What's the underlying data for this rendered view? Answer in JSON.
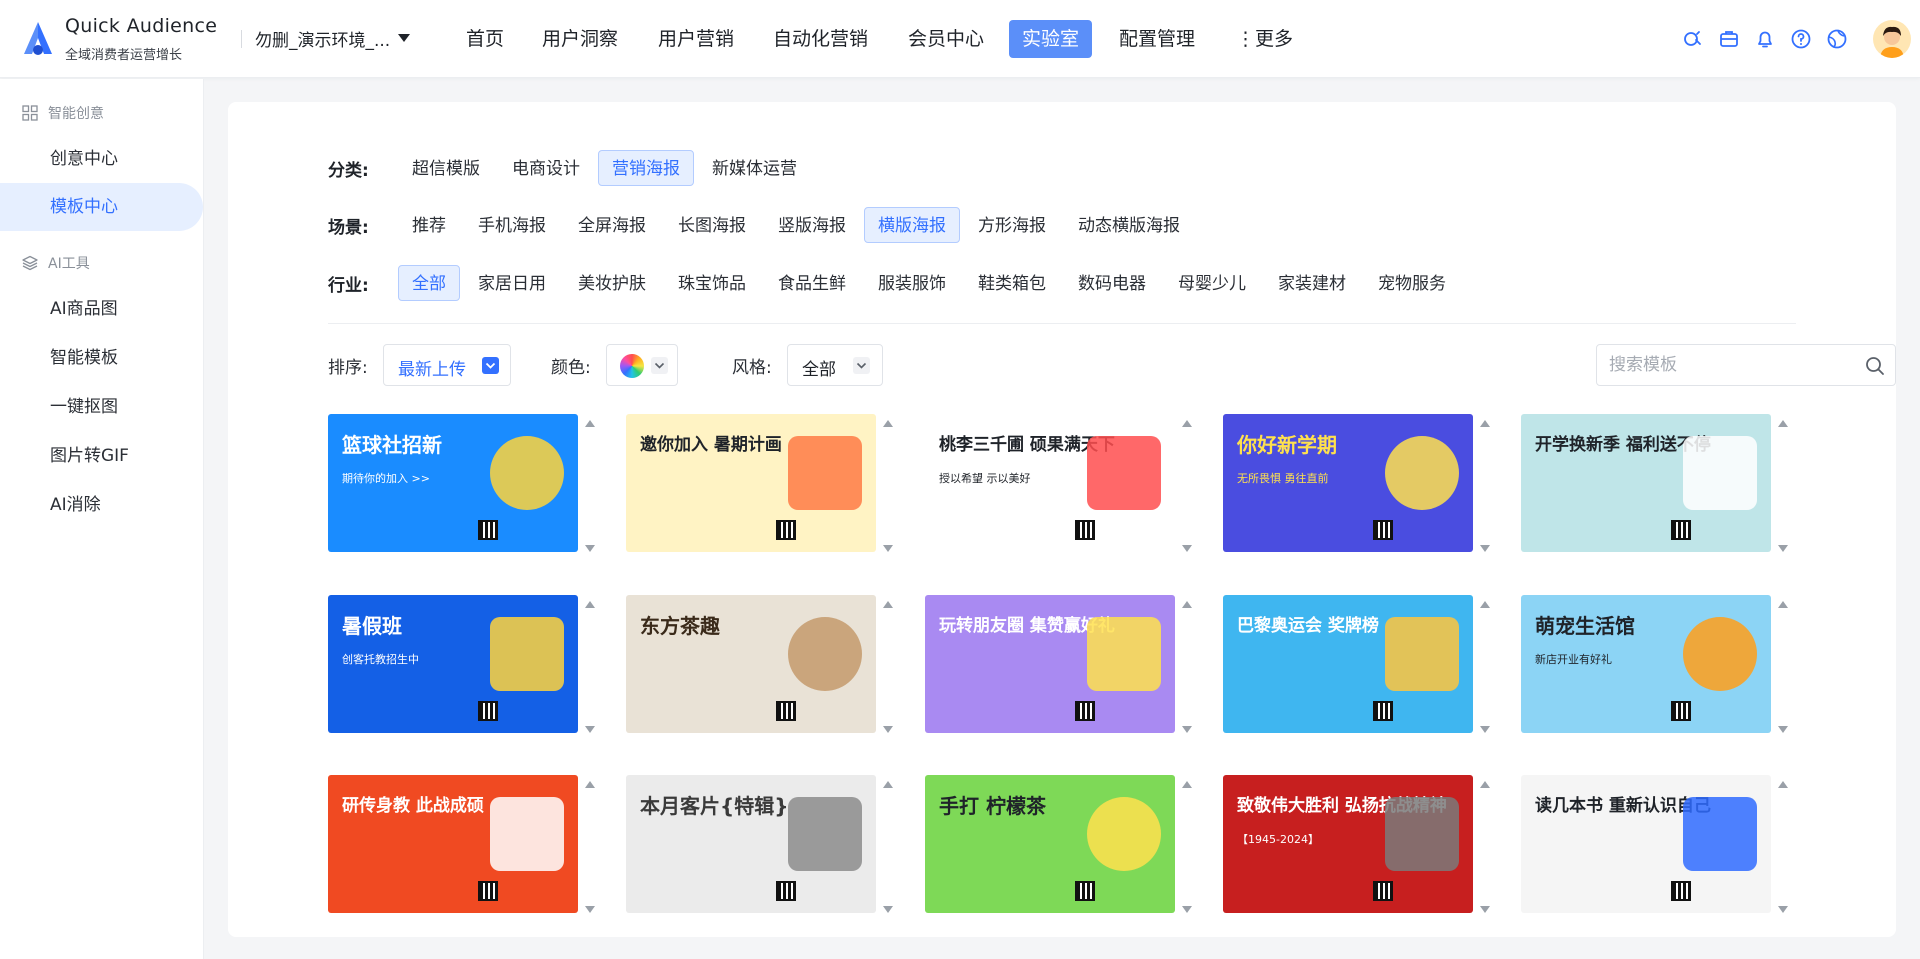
{
  "header": {
    "brand_title": "Quick Audience",
    "brand_subtitle": "全域消费者运营增长",
    "workspace": "勿删_演示环境_...",
    "nav": [
      {
        "label": "首页",
        "active": false
      },
      {
        "label": "用户洞察",
        "active": false
      },
      {
        "label": "用户营销",
        "active": false
      },
      {
        "label": "自动化营销",
        "active": false
      },
      {
        "label": "会员中心",
        "active": false
      },
      {
        "label": "实验室",
        "active": true
      },
      {
        "label": "配置管理",
        "active": false
      },
      {
        "label": "⋮更多",
        "active": false
      }
    ],
    "icons": [
      "ai-assistant-icon",
      "briefcase-icon",
      "bell-icon",
      "help-icon",
      "globe-icon"
    ]
  },
  "sidebar": {
    "groups": [
      {
        "label": "智能创意",
        "icon": "grid-icon",
        "items": [
          {
            "label": "创意中心",
            "active": false
          },
          {
            "label": "模板中心",
            "active": true
          }
        ]
      },
      {
        "label": "AI工具",
        "icon": "layers-icon",
        "items": [
          {
            "label": "AI商品图",
            "active": false
          },
          {
            "label": "智能模板",
            "active": false
          },
          {
            "label": "一键抠图",
            "active": false
          },
          {
            "label": "图片转GIF",
            "active": false
          },
          {
            "label": "AI消除",
            "active": false
          }
        ]
      }
    ]
  },
  "filters": {
    "category": {
      "label": "分类:",
      "options": [
        "超信模版",
        "电商设计",
        "营销海报",
        "新媒体运营"
      ],
      "active": "营销海报"
    },
    "scene": {
      "label": "场景:",
      "options": [
        "推荐",
        "手机海报",
        "全屏海报",
        "长图海报",
        "竖版海报",
        "横版海报",
        "方形海报",
        "动态横版海报"
      ],
      "active": "横版海报"
    },
    "industry": {
      "label": "行业:",
      "options": [
        "全部",
        "家居日用",
        "美妆护肤",
        "珠宝饰品",
        "食品生鲜",
        "服装服饰",
        "鞋类箱包",
        "数码电器",
        "母婴少儿",
        "家装建材",
        "宠物服务"
      ],
      "active": "全部"
    }
  },
  "sort": {
    "sort_label": "排序:",
    "sort_value": "最新上传",
    "color_label": "颜色:",
    "style_label": "风格:",
    "style_value": "全部",
    "search_placeholder": "搜索模板"
  },
  "templates": [
    {
      "title": "篮球社招新",
      "subtitle": "期待你的加入 >>",
      "bg": "#1a8cff",
      "fg": "#ffffff"
    },
    {
      "title": "邀你加入 暑期计画",
      "subtitle": "",
      "bg": "#fff3c4",
      "fg": "#1f2329"
    },
    {
      "title": "桃李三千圃 硕果满天下",
      "subtitle": "授以希望 示以美好",
      "bg": "#ffffff",
      "fg": "#1f2329"
    },
    {
      "title": "你好新学期",
      "subtitle": "无所畏惧 勇往直前",
      "bg": "#4a4de0",
      "fg": "#ffe14d"
    },
    {
      "title": "开学换新季 福利送不停",
      "subtitle": "",
      "bg": "#bfe5e8",
      "fg": "#1f2329"
    },
    {
      "title": "暑假班",
      "subtitle": "创客托教招生中",
      "bg": "#1460e6",
      "fg": "#ffffff"
    },
    {
      "title": "东方茶趣",
      "subtitle": "",
      "bg": "#e9e2d6",
      "fg": "#3a2a1a"
    },
    {
      "title": "玩转朋友圈 集赞赢好礼",
      "subtitle": "",
      "bg": "#a98af2",
      "fg": "#ffffff"
    },
    {
      "title": "巴黎奥运会 奖牌榜",
      "subtitle": "",
      "bg": "#3fb6f0",
      "fg": "#ffffff"
    },
    {
      "title": "萌宠生活馆",
      "subtitle": "新店开业有好礼",
      "bg": "#8cd4f5",
      "fg": "#1f2329"
    },
    {
      "title": "研传身教 此战成硕",
      "subtitle": "",
      "bg": "#f04a22",
      "fg": "#ffffff"
    },
    {
      "title": "本月客片{特辑}",
      "subtitle": "",
      "bg": "#ebebeb",
      "fg": "#3a3a3a"
    },
    {
      "title": "手打 柠檬茶",
      "subtitle": "",
      "bg": "#7ed957",
      "fg": "#1f2329"
    },
    {
      "title": "致敬伟大胜利 弘扬抗战精神",
      "subtitle": "【1945-2024】",
      "bg": "#c71f1f",
      "fg": "#ffffff"
    },
    {
      "title": "读几本书 重新认识自己",
      "subtitle": "",
      "bg": "#f5f5f5",
      "fg": "#1f2329"
    }
  ]
}
